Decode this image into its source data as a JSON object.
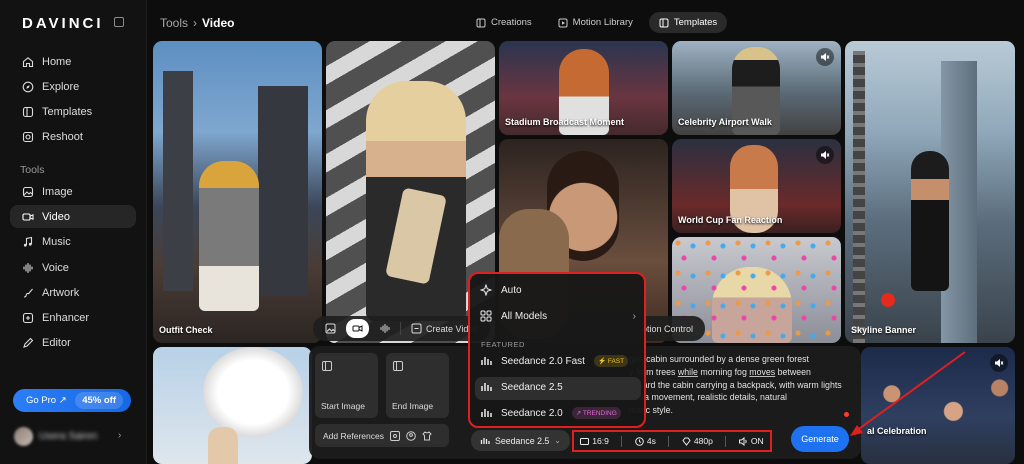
{
  "app": {
    "logo": "DAVINCI"
  },
  "sidebar": {
    "items": [
      {
        "label": "Home",
        "icon": "home-icon"
      },
      {
        "label": "Explore",
        "icon": "compass-icon"
      },
      {
        "label": "Templates",
        "icon": "templates-icon"
      },
      {
        "label": "Reshoot",
        "icon": "reshoot-icon"
      }
    ],
    "tools_heading": "Tools",
    "tools": [
      {
        "label": "Image",
        "icon": "image-icon"
      },
      {
        "label": "Video",
        "icon": "video-icon",
        "active": true
      },
      {
        "label": "Music",
        "icon": "music-icon"
      },
      {
        "label": "Voice",
        "icon": "voice-icon"
      },
      {
        "label": "Artwork",
        "icon": "artwork-icon"
      },
      {
        "label": "Enhancer",
        "icon": "enhancer-icon"
      },
      {
        "label": "Editor",
        "icon": "editor-icon"
      }
    ],
    "gopro": {
      "label": "Go Pro ↗",
      "discount": "45% off"
    },
    "user": {
      "name": "Usera Sairen"
    }
  },
  "header": {
    "breadcrumb": [
      "Tools",
      "Video"
    ],
    "tabs": [
      {
        "label": "Creations",
        "icon": "grid-icon"
      },
      {
        "label": "Motion Library",
        "icon": "play-square-icon"
      },
      {
        "label": "Templates",
        "icon": "templates-icon",
        "active": true
      }
    ]
  },
  "gallery": [
    {
      "caption": "Outfit Check"
    },
    {
      "caption": ""
    },
    {
      "caption": "Stadium Broadcast Moment"
    },
    {
      "caption": "Celebrity Airport Walk"
    },
    {
      "caption": "World Cup Fan Reaction"
    },
    {
      "caption": ""
    },
    {
      "caption": "Skyline Banner"
    },
    {
      "caption": "al Celebration"
    }
  ],
  "toolbar": {
    "create_label": "Create Video",
    "motion_label": "otion Control"
  },
  "composer": {
    "start_image": "Start Image",
    "end_image": "End Image",
    "add_references": "Add References",
    "prompt_parts": {
      "l1": "gen cabin surrounded by a dense green forest",
      "l2a": "y from trees ",
      "while": "while",
      "l2b": " morning fog ",
      "moves": "moves",
      "l2c": " between",
      "l3": "toward the cabin carrying a backpack, with warm lights",
      "l4": "mera movement, realistic details, natural",
      "l5": "matic style."
    },
    "model": "Seedance 2.5",
    "options": {
      "aspect": "16:9",
      "duration": "4s",
      "resolution": "480p",
      "audio": "ON"
    },
    "generate": "Generate"
  },
  "model_dropdown": {
    "auto": "Auto",
    "all_models": "All Models",
    "featured_label": "FEATURED",
    "models": [
      {
        "name": "Seedance 2.0 Fast",
        "badge": "⚡ FAST",
        "badge_color": "#f0c419"
      },
      {
        "name": "Seedance 2.5",
        "badge": ""
      },
      {
        "name": "Seedance 2.0",
        "badge": "↗ TRENDING",
        "badge_color": "#e468d8"
      }
    ]
  },
  "colors": {
    "accent": "#1e72f0",
    "highlight_box": "#e01f1f"
  }
}
